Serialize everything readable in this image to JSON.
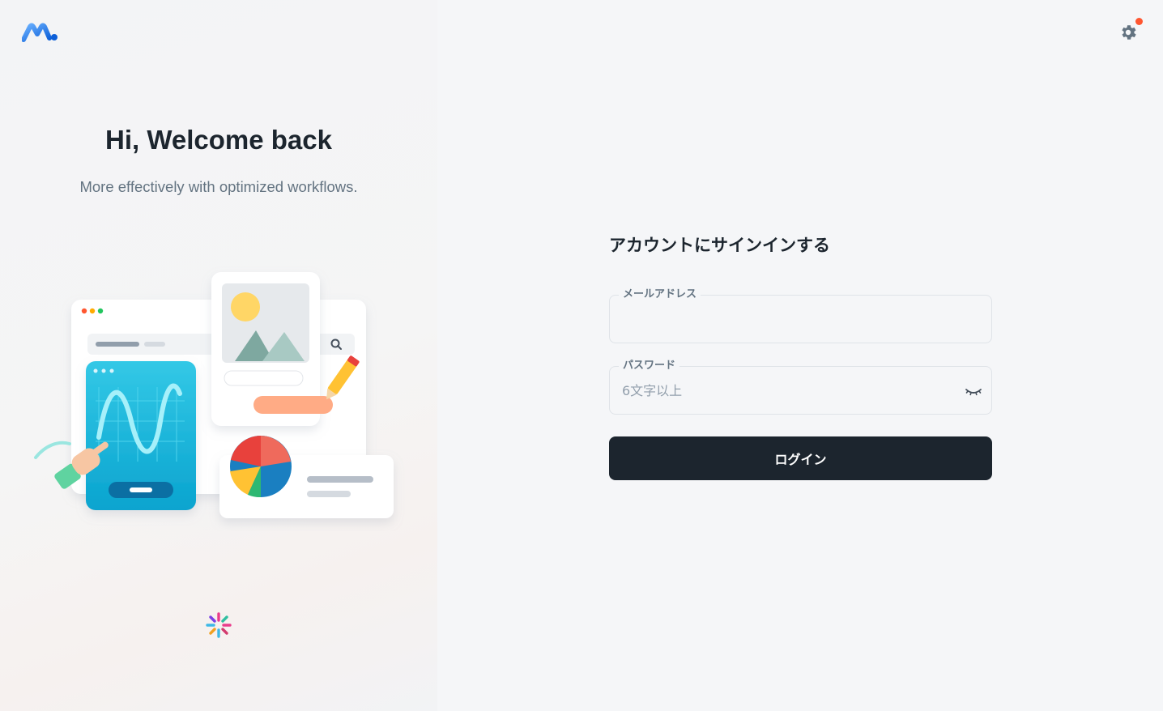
{
  "brand": {
    "logo_icon": "brand-logo-icon",
    "mark_icon": "spark-mark-icon",
    "primary_color": "#1d6bf2"
  },
  "hero": {
    "title": "Hi, Welcome back",
    "subtitle": "More effectively with optimized workflows."
  },
  "header": {
    "settings_icon": "gear-icon",
    "notification_dot_color": "#ff5630"
  },
  "login": {
    "title": "アカウントにサインインする",
    "email": {
      "label": "メールアドレス",
      "value": "",
      "placeholder": ""
    },
    "password": {
      "label": "パスワード",
      "value": "",
      "placeholder": "6文字以上",
      "toggle_icon": "eye-closed-icon"
    },
    "submit_label": "ログイン",
    "button_color": "#1c252e"
  }
}
